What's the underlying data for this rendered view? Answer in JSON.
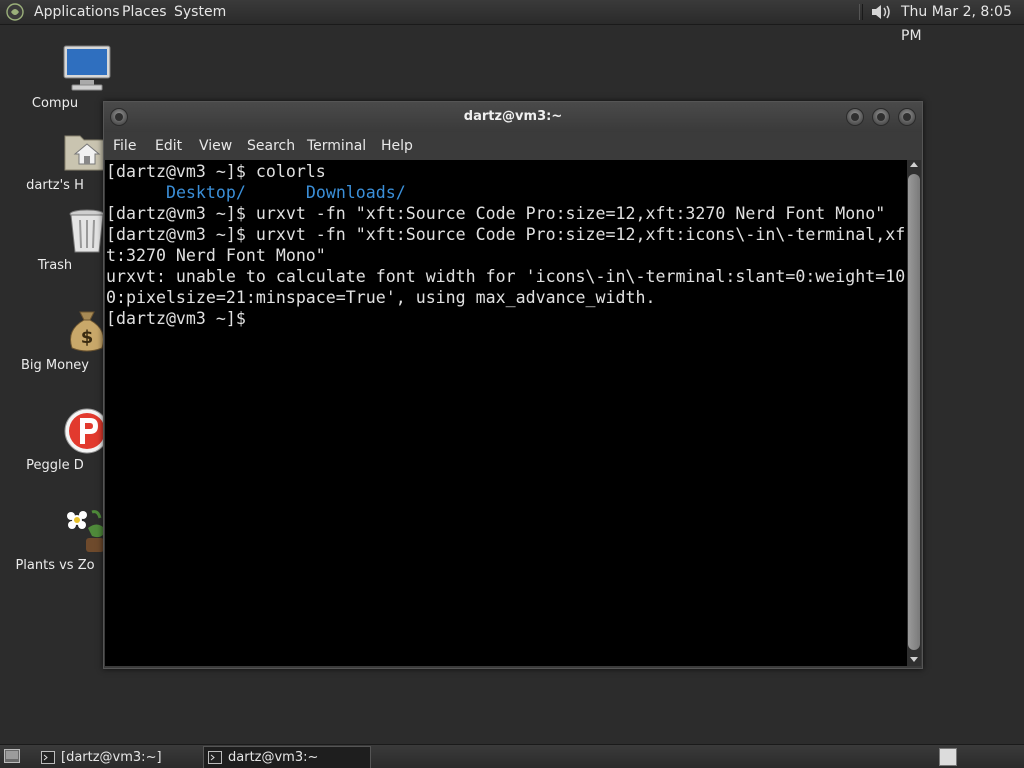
{
  "top_panel": {
    "menus": [
      "Applications",
      "Places",
      "System"
    ],
    "clock": "Thu Mar  2,  8:05 PM"
  },
  "desktop": {
    "icons": [
      {
        "label": "Compu",
        "icon": "computer-icon"
      },
      {
        "label": "dartz's H",
        "icon": "home-folder-icon"
      },
      {
        "label": "Trash",
        "icon": "trash-icon"
      },
      {
        "label": "Big Money",
        "icon": "money-bag-icon"
      },
      {
        "label": "Peggle D",
        "icon": "peggle-icon"
      },
      {
        "label": "Plants vs Zo",
        "icon": "plants-vs-zombies-icon"
      }
    ]
  },
  "window": {
    "title": "dartz@vm3:~",
    "menu": [
      "File",
      "Edit",
      "View",
      "Search",
      "Terminal",
      "Help"
    ]
  },
  "terminal": {
    "lines": [
      "[dartz@vm3 ~]$ colorls",
      "",
      "[dartz@vm3 ~]$ urxvt -fn \"xft:Source Code Pro:size=12,xft:3270 Nerd Font Mono\"",
      "[dartz@vm3 ~]$ urxvt -fn \"xft:Source Code Pro:size=12,xft:icons\\-in\\-terminal,xf",
      "t:3270 Nerd Font Mono\"",
      "urxvt: unable to calculate font width for 'icons\\-in\\-terminal:slant=0:weight=10",
      "0:pixelsize=21:minspace=True', using max_advance_width.",
      "[dartz@vm3 ~]$ "
    ],
    "dir_glyph": "",
    "dirs": [
      "Desktop/",
      "Downloads/"
    ]
  },
  "taskbar": {
    "tasks": [
      "[dartz@vm3:~]",
      "dartz@vm3:~"
    ]
  },
  "colors": {
    "desktop_bg": "#2c2c2c",
    "terminal_bg": "#000000",
    "terminal_fg": "#e0e0e0",
    "dir_color": "#3b8fd8"
  }
}
